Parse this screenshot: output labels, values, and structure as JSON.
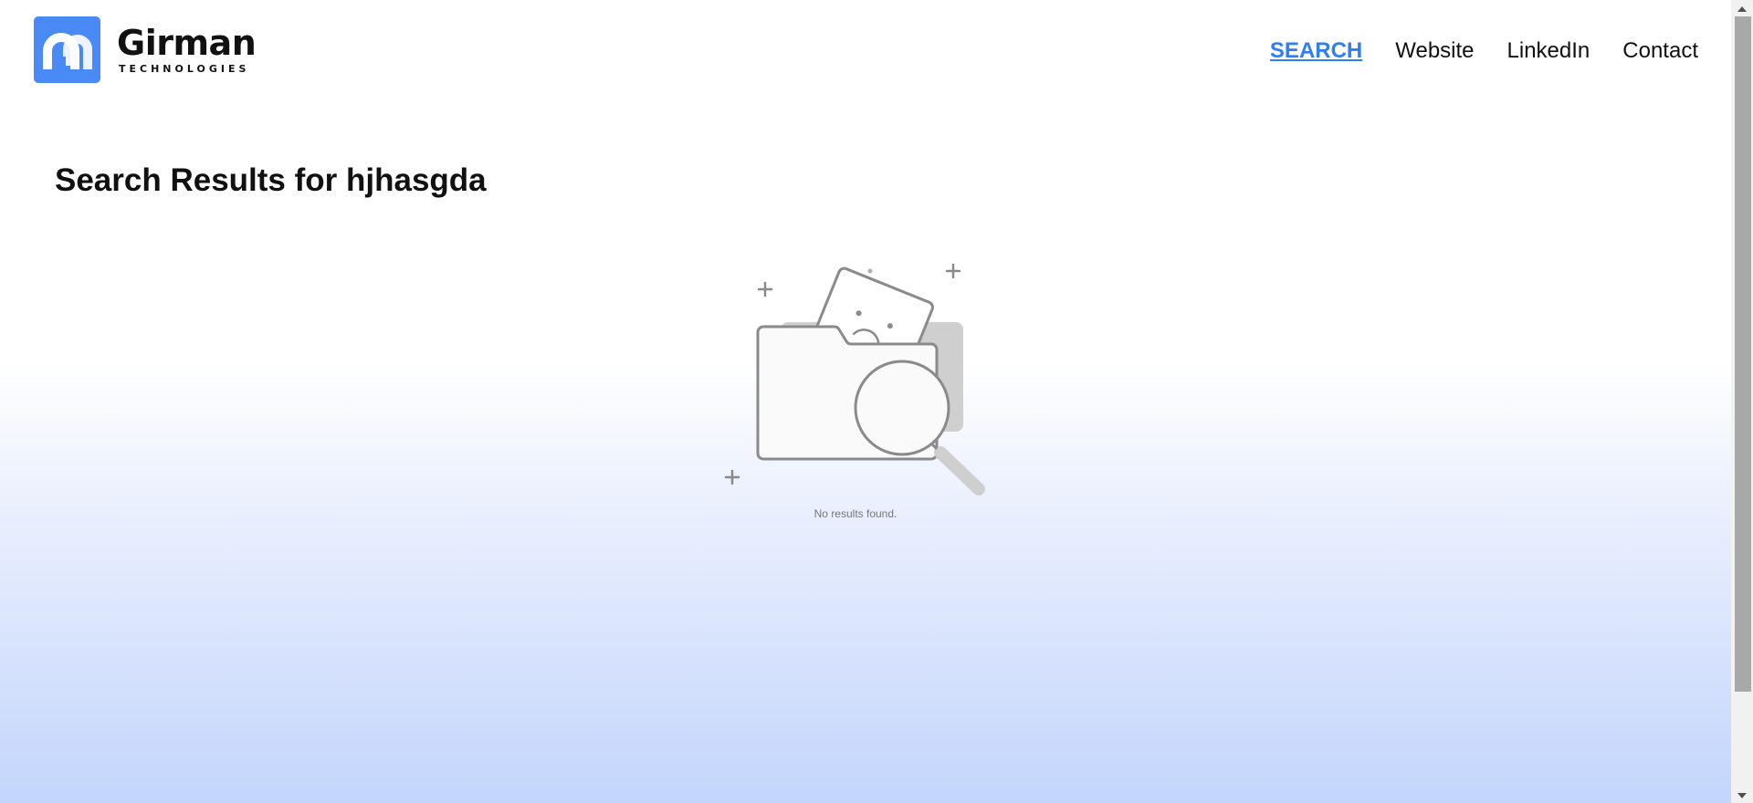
{
  "logo": {
    "name": "Girman",
    "subtitle": "TECHNOLOGIES"
  },
  "nav": {
    "items": [
      {
        "label": "SEARCH",
        "active": true
      },
      {
        "label": "Website",
        "active": false
      },
      {
        "label": "LinkedIn",
        "active": false
      },
      {
        "label": "Contact",
        "active": false
      }
    ]
  },
  "main": {
    "title": "Search Results for hjhasgda",
    "empty_message": "No results found."
  },
  "colors": {
    "accent": "#2f7ef2",
    "logo_bg": "#4a8af7",
    "gradient_end": "#c3d5fc"
  },
  "icons": {
    "logo": "girman-logo-icon",
    "empty_state": "empty-folder-search-illustration"
  }
}
